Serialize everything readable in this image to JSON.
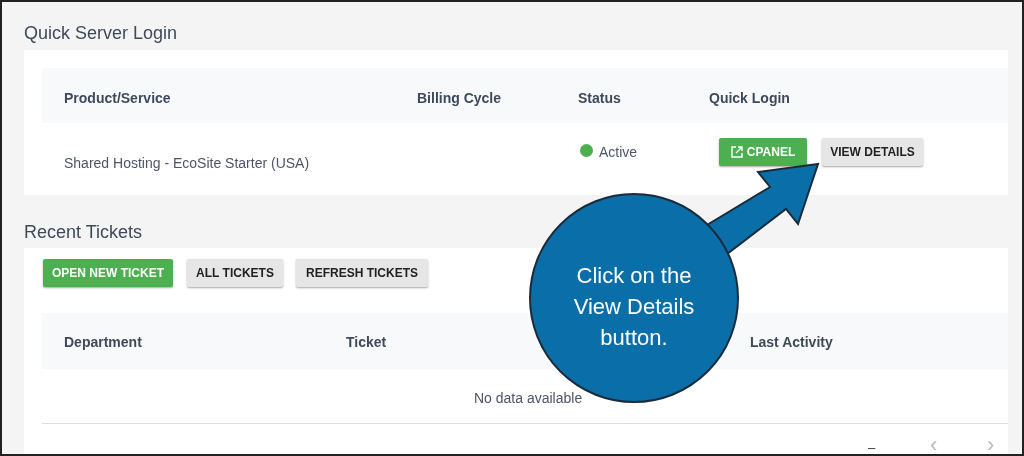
{
  "login_section": {
    "title": "Quick Server Login",
    "table": {
      "columns": [
        "Product/Service",
        "Billing Cycle",
        "Status",
        "Quick Login"
      ],
      "rows": [
        {
          "product": "Shared Hosting - EcoSite Starter (USA)",
          "status": "Active",
          "color": "#4caf50",
          "buttons": [
            {
              "label": "CPANEL",
              "kind": "primary"
            },
            {
              "label": "VIEW DETAILS",
              "kind": "secondary"
            }
          ]
        }
      ]
    }
  },
  "tickets_section": {
    "title": "Recent Tickets",
    "buttons": [
      {
        "label": "OPEN NEW TICKET",
        "kind": "primary"
      },
      {
        "label": "ALL TICKETS",
        "kind": "secondary"
      },
      {
        "label": "REFRESH TICKETS",
        "kind": "secondary"
      }
    ],
    "table": {
      "columns": [
        "Department",
        "Ticket",
        "Last Activity"
      ],
      "empty_message": "No data available",
      "pagination": {
        "range": "–",
        "prev": "‹",
        "next": "›"
      }
    }
  },
  "callout": {
    "text": "Click on the View Details button."
  }
}
